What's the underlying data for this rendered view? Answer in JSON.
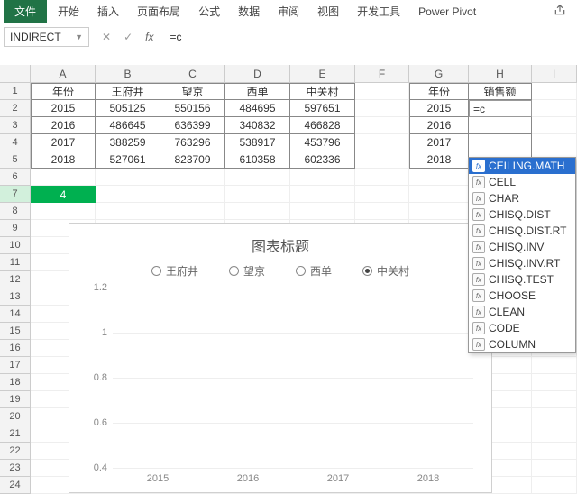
{
  "menu": {
    "file": "文件",
    "tabs": [
      "开始",
      "插入",
      "页面布局",
      "公式",
      "数据",
      "审阅",
      "视图",
      "开发工具",
      "Power Pivot"
    ]
  },
  "formula_bar": {
    "namebox": "INDIRECT",
    "cancel": "✕",
    "confirm": "✓",
    "fx": "fx",
    "value": "=c"
  },
  "columns": [
    "A",
    "B",
    "C",
    "D",
    "E",
    "F",
    "G",
    "H",
    "I"
  ],
  "table1": {
    "headers": [
      "年份",
      "王府井",
      "望京",
      "西单",
      "中关村"
    ],
    "rows": [
      [
        "2015",
        "505125",
        "550156",
        "484695",
        "597651"
      ],
      [
        "2016",
        "486645",
        "636399",
        "340832",
        "466828"
      ],
      [
        "2017",
        "388259",
        "763296",
        "538917",
        "453796"
      ],
      [
        "2018",
        "527061",
        "823709",
        "610358",
        "602336"
      ]
    ]
  },
  "table2": {
    "headers": [
      "年份",
      "销售额"
    ],
    "rows": [
      [
        "2015",
        "=c"
      ],
      [
        "2016",
        ""
      ],
      [
        "2017",
        ""
      ],
      [
        "2018",
        ""
      ]
    ]
  },
  "extra_cell": {
    "row": 7,
    "value": "4"
  },
  "autocomplete": {
    "items": [
      "CEILING.MATH",
      "CELL",
      "CHAR",
      "CHISQ.DIST",
      "CHISQ.DIST.RT",
      "CHISQ.INV",
      "CHISQ.INV.RT",
      "CHISQ.TEST",
      "CHOOSE",
      "CLEAN",
      "CODE",
      "COLUMN"
    ],
    "selected": 0
  },
  "chart_data": {
    "type": "line",
    "title": "图表标题",
    "series_names": [
      "王府井",
      "望京",
      "西单",
      "中关村"
    ],
    "selected_series": 3,
    "categories": [
      "2015",
      "2016",
      "2017",
      "2018"
    ],
    "yticks": [
      "1.2",
      "1",
      "0.8",
      "0.6",
      "0.4"
    ],
    "ylim": [
      0,
      1.2
    ]
  }
}
